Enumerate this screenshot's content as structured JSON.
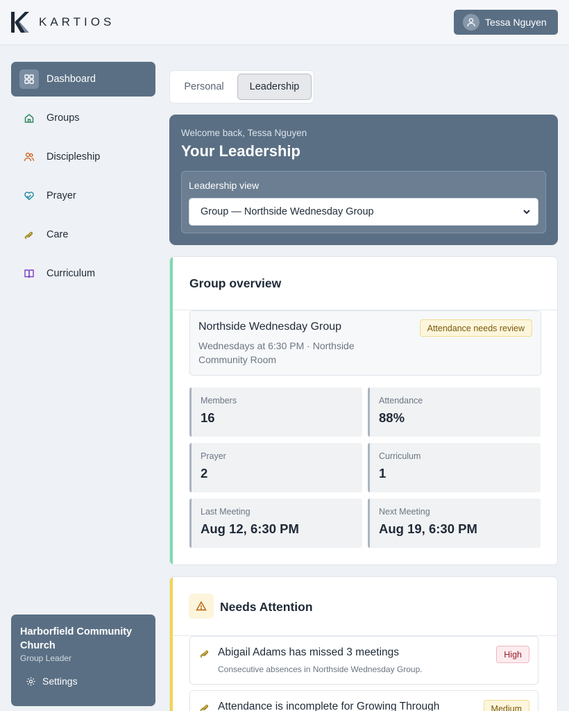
{
  "app": {
    "brand": "KARTIOS"
  },
  "user": {
    "name": "Tessa Nguyen"
  },
  "sidebar": {
    "items": [
      {
        "label": "Dashboard",
        "icon": "dashboard-icon",
        "color": "#ffffff",
        "active": true
      },
      {
        "label": "Groups",
        "icon": "home-icon",
        "color": "#2f8a5f"
      },
      {
        "label": "Discipleship",
        "icon": "users-icon",
        "color": "#d06a2c"
      },
      {
        "label": "Prayer",
        "icon": "heart-hands-icon",
        "color": "#1f8aa0"
      },
      {
        "label": "Care",
        "icon": "hand-icon",
        "color": "#a08316"
      },
      {
        "label": "Curriculum",
        "icon": "book-icon",
        "color": "#7c3fc4"
      }
    ],
    "footer": {
      "org": "Harborfield Community Church",
      "role": "Group Leader",
      "settings": "Settings"
    }
  },
  "tabs": {
    "personal": "Personal",
    "leadership": "Leadership",
    "active": "Leadership"
  },
  "hero": {
    "welcome": "Welcome back, Tessa Nguyen",
    "title": "Your Leadership",
    "view_label": "Leadership view",
    "view_value": "Group — Northside Wednesday Group"
  },
  "overview": {
    "title": "Group overview",
    "accent": "#7fd9b0",
    "group": {
      "name": "Northside Wednesday Group",
      "meta": "Wednesdays at 6:30 PM · Northside Community Room",
      "badge": "Attendance needs review"
    },
    "stats": [
      {
        "label": "Members",
        "value": "16"
      },
      {
        "label": "Attendance",
        "value": "88%"
      },
      {
        "label": "Prayer",
        "value": "2"
      },
      {
        "label": "Curriculum",
        "value": "1"
      },
      {
        "label": "Last Meeting",
        "value": "Aug 12, 6:30 PM"
      },
      {
        "label": "Next Meeting",
        "value": "Aug 19, 6:30 PM"
      }
    ]
  },
  "attention": {
    "title": "Needs Attention",
    "accent": "#f4d44d",
    "items": [
      {
        "title": "Abigail Adams has missed 3 meetings",
        "desc": "Consecutive absences in Northside Wednesday Group.",
        "priority": "High"
      },
      {
        "title": "Attendance is incomplete for Growing Through",
        "desc": "",
        "priority": "Medium"
      }
    ]
  }
}
